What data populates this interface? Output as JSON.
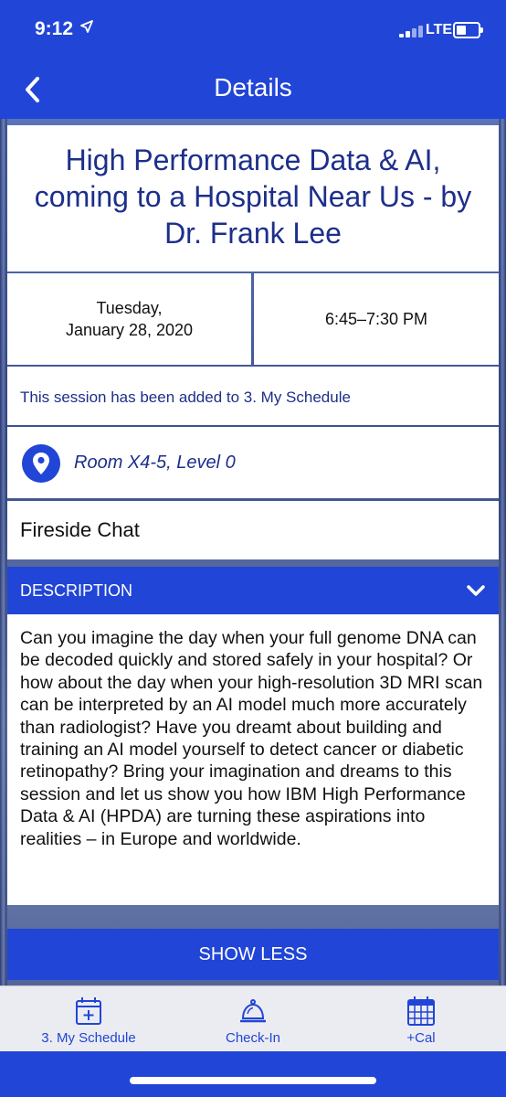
{
  "status_bar": {
    "time": "9:12",
    "network": "LTE"
  },
  "nav": {
    "title": "Details"
  },
  "session": {
    "title": "High Performance Data & AI, coming to a Hospital Near Us - by  Dr. Frank Lee",
    "date_line1": "Tuesday,",
    "date_line2": "January 28, 2020",
    "time": "6:45–7:30 PM",
    "added_notice": "This session has been added to 3. My Schedule",
    "room": "Room X4-5, Level 0",
    "type": "Fireside Chat",
    "description_header": "DESCRIPTION",
    "description": "Can you imagine the day when your full genome DNA can be decoded quickly and stored safely in your hospital? Or how about the day when your high-resolution 3D MRI scan can be interpreted by an AI model much more accurately than radiologist? Have you dreamt about building and training an AI model yourself to detect cancer or diabetic retinopathy? Bring your imagination and dreams to this session and let us show you how IBM High Performance Data & AI (HPDA) are turning these aspirations into realities – in Europe and worldwide.",
    "show_less_label": "SHOW LESS"
  },
  "tabs": [
    {
      "label": "3. My Schedule",
      "icon": "calendar-add-icon"
    },
    {
      "label": "Check-In",
      "icon": "service-bell-icon"
    },
    {
      "label": "+Cal",
      "icon": "calendar-grid-icon"
    }
  ],
  "colors": {
    "primary": "#2145d6",
    "title_text": "#1d2f8a",
    "tab_bar": "#ebecf1"
  }
}
